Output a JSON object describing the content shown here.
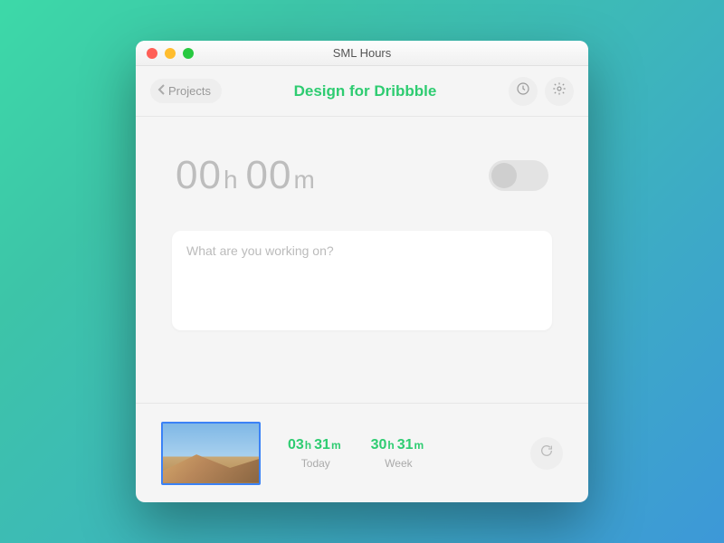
{
  "window": {
    "title": "SML Hours"
  },
  "header": {
    "back_label": "Projects",
    "page_title": "Design for Dribbble"
  },
  "timer": {
    "hours": "00",
    "hours_unit": "h",
    "minutes": "00",
    "minutes_unit": "m",
    "running": false
  },
  "note": {
    "placeholder": "What are you working on?",
    "value": ""
  },
  "footer": {
    "today": {
      "hours": "03",
      "minutes": "31",
      "label": "Today"
    },
    "week": {
      "hours": "30",
      "minutes": "31",
      "label": "Week"
    }
  },
  "colors": {
    "accent": "#2ecc71",
    "thumbnail_border": "#3b82f6"
  }
}
